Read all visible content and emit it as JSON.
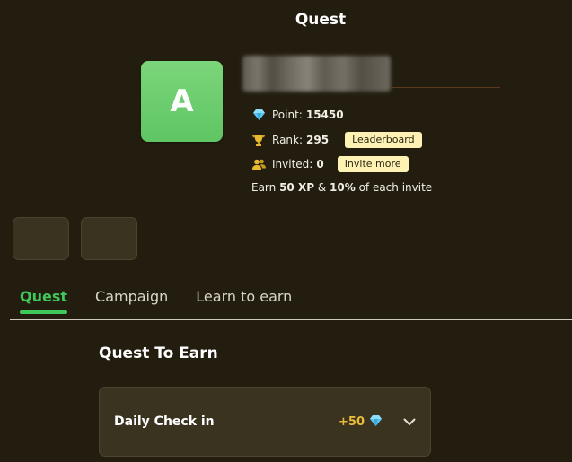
{
  "header": {
    "title": "Quest"
  },
  "profile": {
    "avatar_letter": "A",
    "stats": {
      "point_label": "Point:",
      "point_value": "15450",
      "rank_label": "Rank:",
      "rank_value": "295",
      "leaderboard_label": "Leaderboard",
      "invited_label": "Invited:",
      "invited_value": "0",
      "invite_more_label": "Invite more"
    },
    "earn_text": {
      "prefix": "Earn ",
      "xp": "50 XP",
      "middle": " & ",
      "percent": "10%",
      "suffix": " of each invite"
    },
    "icons": {
      "point": "diamond-icon",
      "rank": "trophy-icon",
      "invited": "users-icon"
    }
  },
  "tabs": [
    {
      "label": "Quest",
      "active": true
    },
    {
      "label": "Campaign",
      "active": false
    },
    {
      "label": "Learn to earn",
      "active": false
    }
  ],
  "main": {
    "section_title": "Quest To Earn",
    "quests": [
      {
        "name": "Daily Check in",
        "reward": "+50",
        "reward_icon": "diamond-icon",
        "expand_icon": "chevron-down-icon"
      }
    ]
  },
  "colors": {
    "background": "#231d0f",
    "accent": "#3fc85a",
    "avatar_green": "#6fce6f",
    "pill_yellow": "#fdf2b4",
    "reward_gold": "#e9bb3a",
    "card": "#3a3320"
  }
}
